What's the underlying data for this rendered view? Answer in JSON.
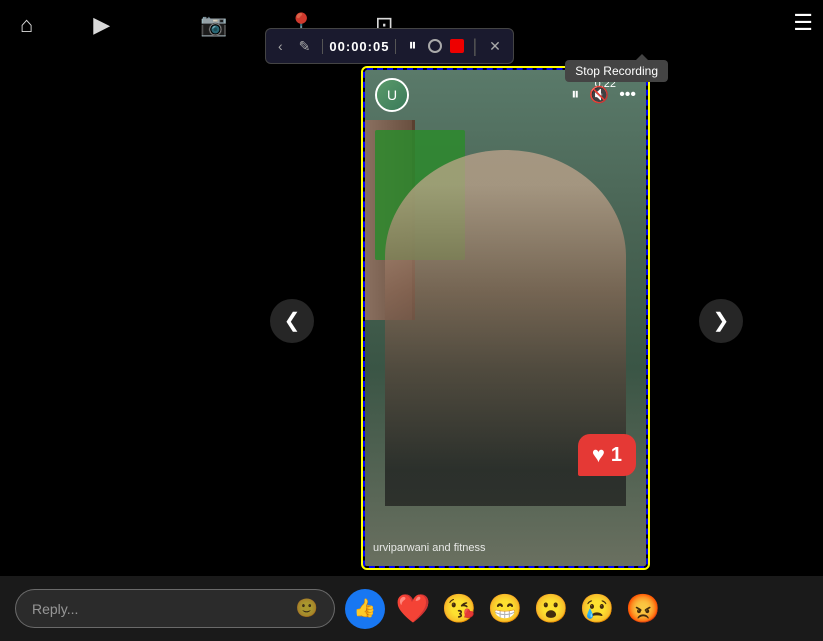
{
  "topBar": {
    "icons": [
      "home",
      "tv",
      "camera",
      "location",
      "screen"
    ]
  },
  "recordingToolbar": {
    "backLabel": "‹",
    "editLabel": "✎",
    "time": "00:00:05",
    "pauseLabel": "⏸",
    "closeLabel": "✕"
  },
  "tooltip": {
    "text": "Stop Recording"
  },
  "video": {
    "timestamp": "0:22",
    "username": "urviparwani and fitness",
    "likeCount": "1"
  },
  "bottomBar": {
    "replyPlaceholder": "Reply...",
    "reactions": [
      "👍",
      "❤️",
      "😘",
      "😁",
      "😮",
      "😢",
      "😡"
    ]
  },
  "navArrows": {
    "left": "❮",
    "right": "❯"
  }
}
